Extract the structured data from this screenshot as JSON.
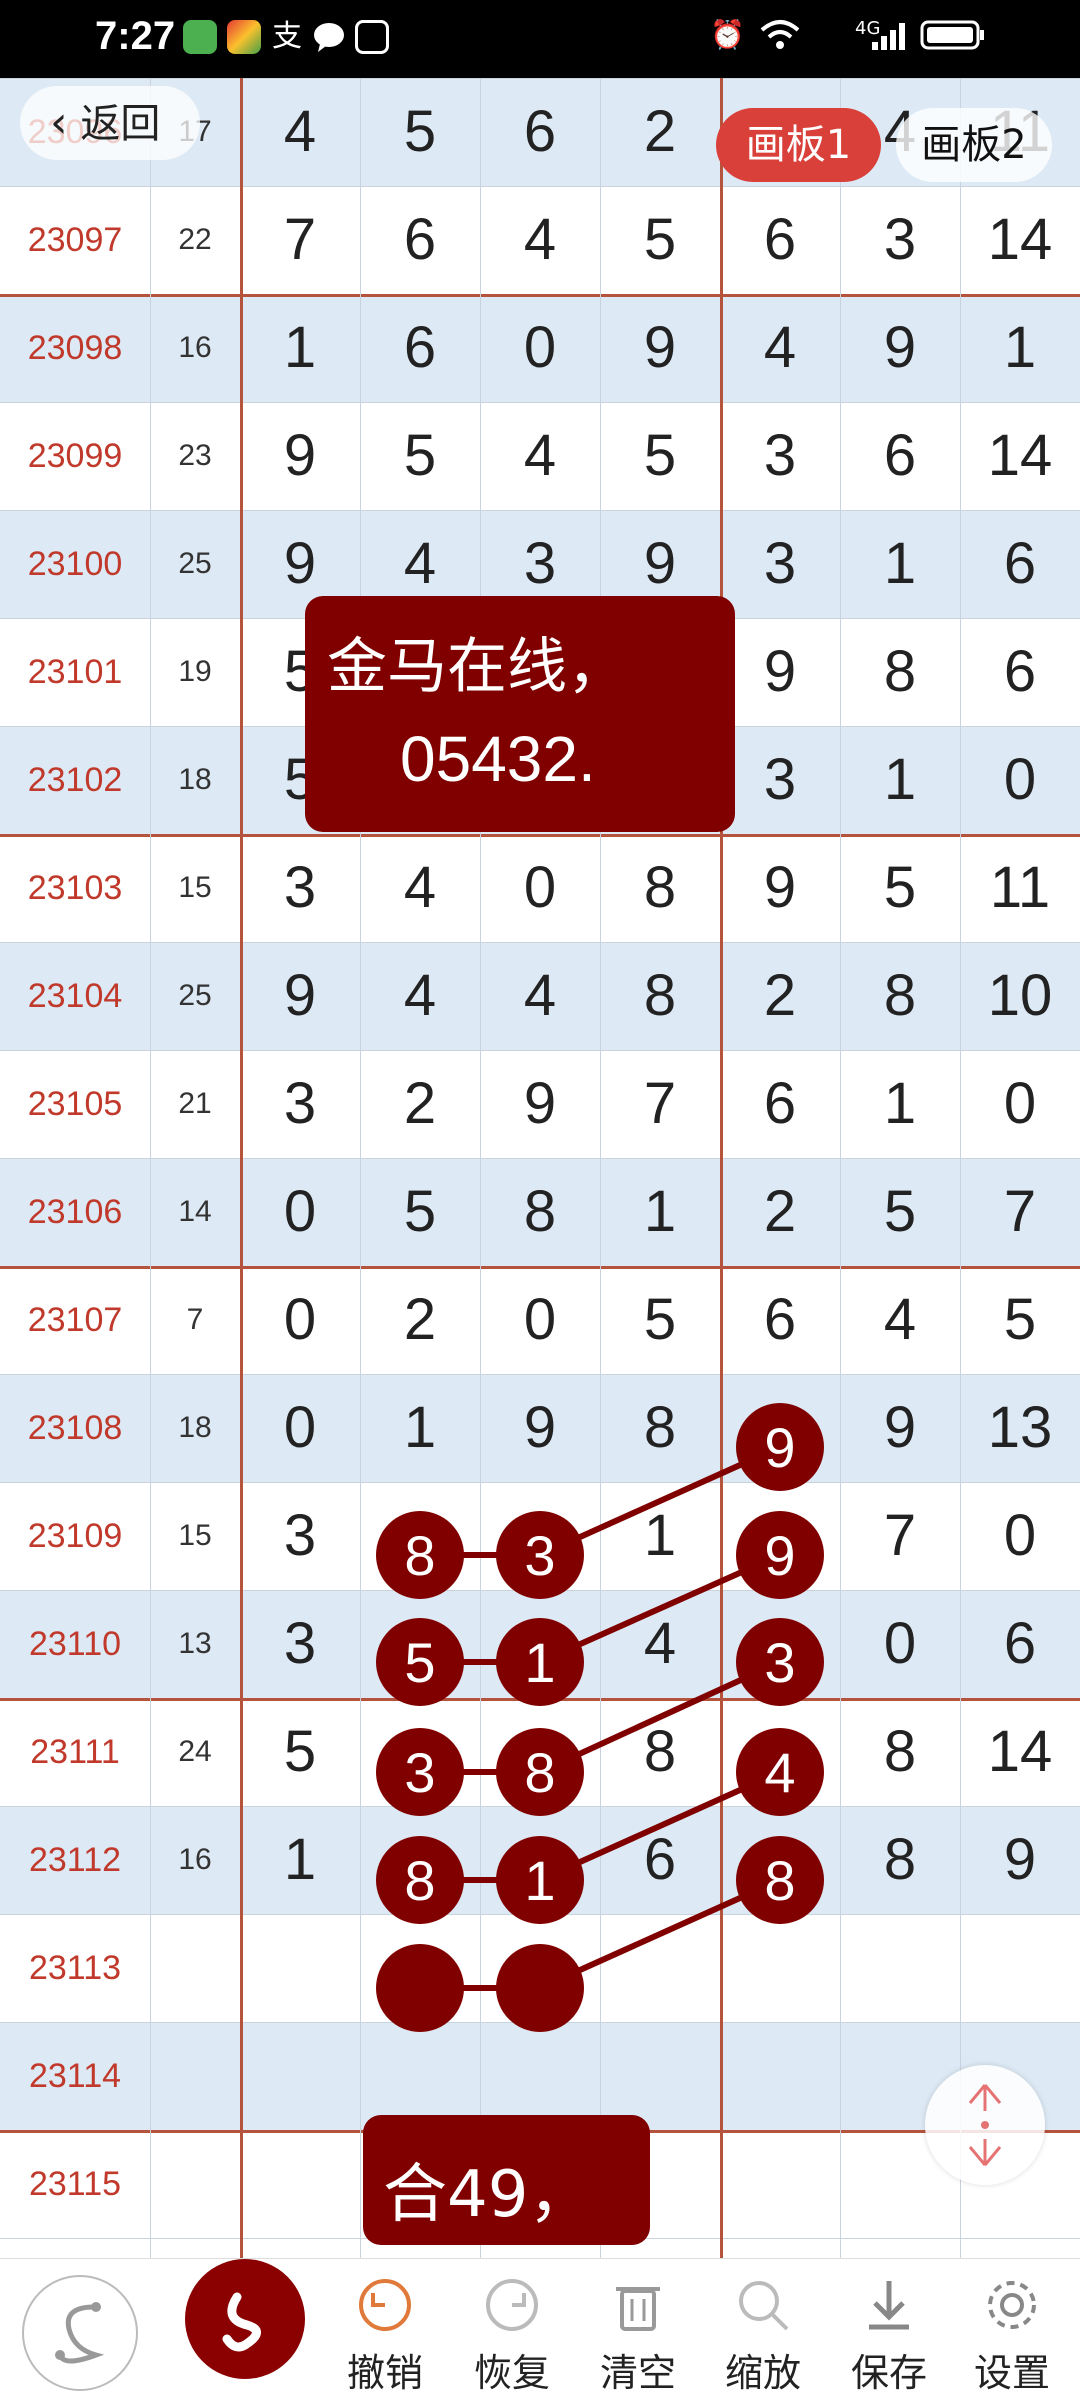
{
  "status_bar": {
    "time": "7:27",
    "carrier_icons": [
      "wechat-mini-icon",
      "calendar-icon",
      "alipay-icon",
      "chat-icon",
      "huawei-icon"
    ],
    "right_text": "4G"
  },
  "nav": {
    "back_label": "返回",
    "tab1": "画板1",
    "tab2": "画板2"
  },
  "popup_top": {
    "line1": "金马在线，",
    "line2": "05432."
  },
  "popup_bottom": {
    "text": "合49，"
  },
  "rows": [
    {
      "issue": "23096",
      "sum": "17",
      "d": [
        "4",
        "5",
        "6",
        "2",
        "4",
        "4",
        "11"
      ]
    },
    {
      "issue": "23097",
      "sum": "22",
      "d": [
        "7",
        "6",
        "4",
        "5",
        "6",
        "3",
        "14"
      ]
    },
    {
      "issue": "23098",
      "sum": "16",
      "d": [
        "1",
        "6",
        "0",
        "9",
        "4",
        "9",
        "1"
      ]
    },
    {
      "issue": "23099",
      "sum": "23",
      "d": [
        "9",
        "5",
        "4",
        "5",
        "3",
        "6",
        "14"
      ]
    },
    {
      "issue": "23100",
      "sum": "25",
      "d": [
        "9",
        "4",
        "3",
        "9",
        "3",
        "1",
        "6"
      ]
    },
    {
      "issue": "23101",
      "sum": "19",
      "d": [
        "5",
        "",
        "",
        "",
        "9",
        "8",
        "6"
      ]
    },
    {
      "issue": "23102",
      "sum": "18",
      "d": [
        "5",
        "",
        "",
        "",
        "3",
        "1",
        "0"
      ]
    },
    {
      "issue": "23103",
      "sum": "15",
      "d": [
        "3",
        "4",
        "0",
        "8",
        "9",
        "5",
        "11"
      ]
    },
    {
      "issue": "23104",
      "sum": "25",
      "d": [
        "9",
        "4",
        "4",
        "8",
        "2",
        "8",
        "10"
      ]
    },
    {
      "issue": "23105",
      "sum": "21",
      "d": [
        "3",
        "2",
        "9",
        "7",
        "6",
        "1",
        "0"
      ]
    },
    {
      "issue": "23106",
      "sum": "14",
      "d": [
        "0",
        "5",
        "8",
        "1",
        "2",
        "5",
        "7"
      ]
    },
    {
      "issue": "23107",
      "sum": "7",
      "d": [
        "0",
        "2",
        "0",
        "5",
        "6",
        "4",
        "5"
      ]
    },
    {
      "issue": "23108",
      "sum": "18",
      "d": [
        "0",
        "1",
        "9",
        "8",
        "9",
        "9",
        "13"
      ]
    },
    {
      "issue": "23109",
      "sum": "15",
      "d": [
        "3",
        "8",
        "3",
        "1",
        "9",
        "7",
        "0"
      ]
    },
    {
      "issue": "23110",
      "sum": "13",
      "d": [
        "3",
        "5",
        "1",
        "4",
        "3",
        "0",
        "6"
      ]
    },
    {
      "issue": "23111",
      "sum": "24",
      "d": [
        "5",
        "3",
        "8",
        "8",
        "4",
        "8",
        "14"
      ]
    },
    {
      "issue": "23112",
      "sum": "16",
      "d": [
        "1",
        "8",
        "1",
        "6",
        "8",
        "8",
        "9"
      ]
    },
    {
      "issue": "23113",
      "sum": "",
      "d": [
        "",
        "",
        "",
        "",
        "",
        "",
        ""
      ]
    },
    {
      "issue": "23114",
      "sum": "",
      "d": [
        "",
        "",
        "",
        "",
        "",
        "",
        ""
      ]
    },
    {
      "issue": "23115",
      "sum": "",
      "d": [
        "",
        "",
        "",
        "",
        "",
        "",
        ""
      ]
    }
  ],
  "toolbar": {
    "undo": "撤销",
    "redo": "恢复",
    "clear": "清空",
    "zoom": "缩放",
    "save": "保存",
    "settings": "设置"
  },
  "colors": {
    "accent": "#800000",
    "issue_text": "#c0392b",
    "shade": "#dde9f4",
    "grid_brown": "#b5533c",
    "tab_active": "#d9403a"
  }
}
